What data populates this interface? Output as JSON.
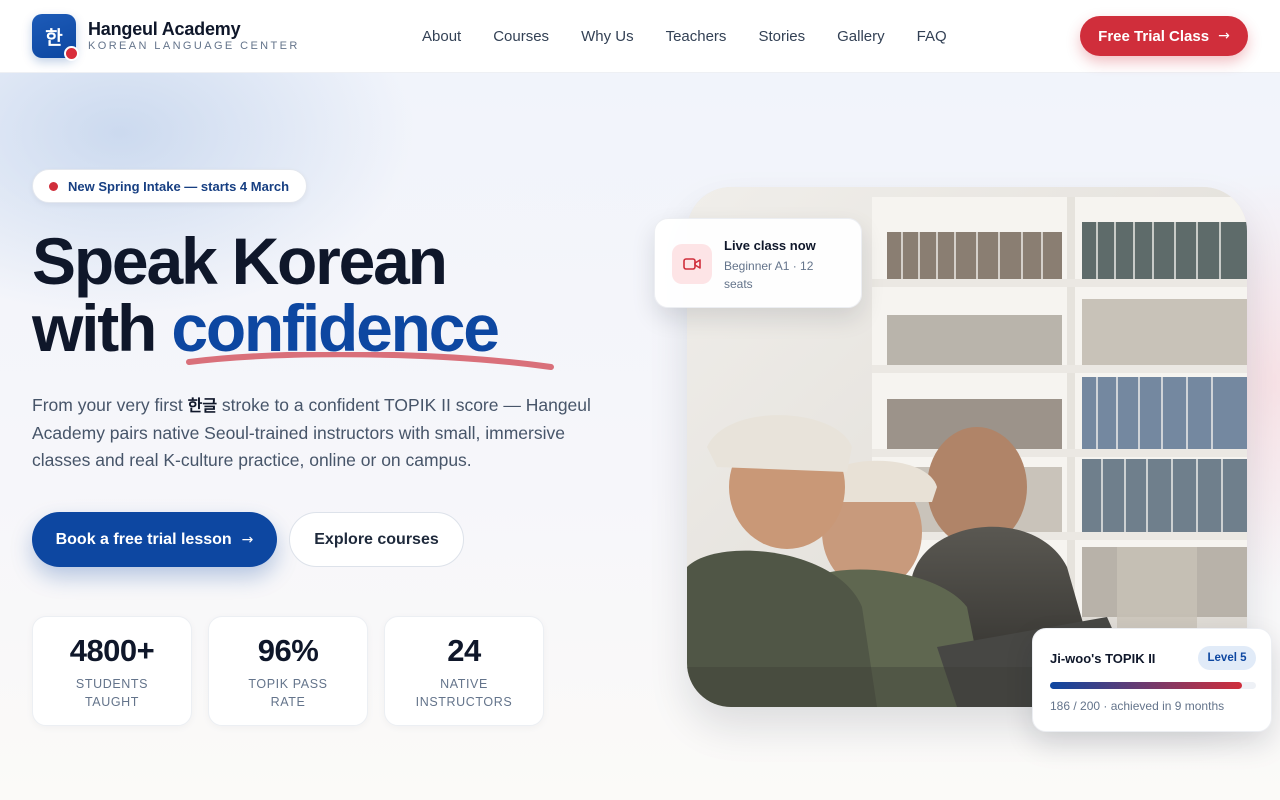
{
  "brand": {
    "logo_glyph": "한",
    "name": "Hangeul Academy",
    "tagline": "KOREAN LANGUAGE CENTER",
    "primary_color": "#0d47a1",
    "accent_color": "#d02e3b"
  },
  "nav": {
    "links": [
      "About",
      "Courses",
      "Why Us",
      "Teachers",
      "Stories",
      "Gallery",
      "FAQ"
    ],
    "cta_label": "Free Trial Class"
  },
  "hero": {
    "announcement": "New Spring Intake — starts 4 March",
    "heading_line1": "Speak Korean",
    "heading_line2_prefix": "with",
    "heading_line2_accent": "confidence",
    "lead_part1": "From your very first",
    "lead_hangul": "한글",
    "lead_part2": "stroke to a confident TOPIK II score — Hangeul Academy pairs native Seoul-trained instructors with small, immersive classes and real K-culture practice, online or on campus.",
    "primary_cta": "Book a free trial lesson",
    "secondary_cta": "Explore courses"
  },
  "stats": [
    {
      "value": "4800+",
      "label": "STUDENTS TAUGHT"
    },
    {
      "value": "96%",
      "label": "TOPIK PASS RATE"
    },
    {
      "value": "24",
      "label": "NATIVE INSTRUCTORS"
    }
  ],
  "live_card": {
    "icon": "video-camera-icon",
    "title": "Live class now",
    "subtitle": "Beginner A1 · 12 seats"
  },
  "progress_card": {
    "title": "Ji-woo's TOPIK II",
    "badge": "Level 5",
    "progress_fraction": 0.93,
    "caption": "186 / 200 · achieved in 9 months"
  }
}
